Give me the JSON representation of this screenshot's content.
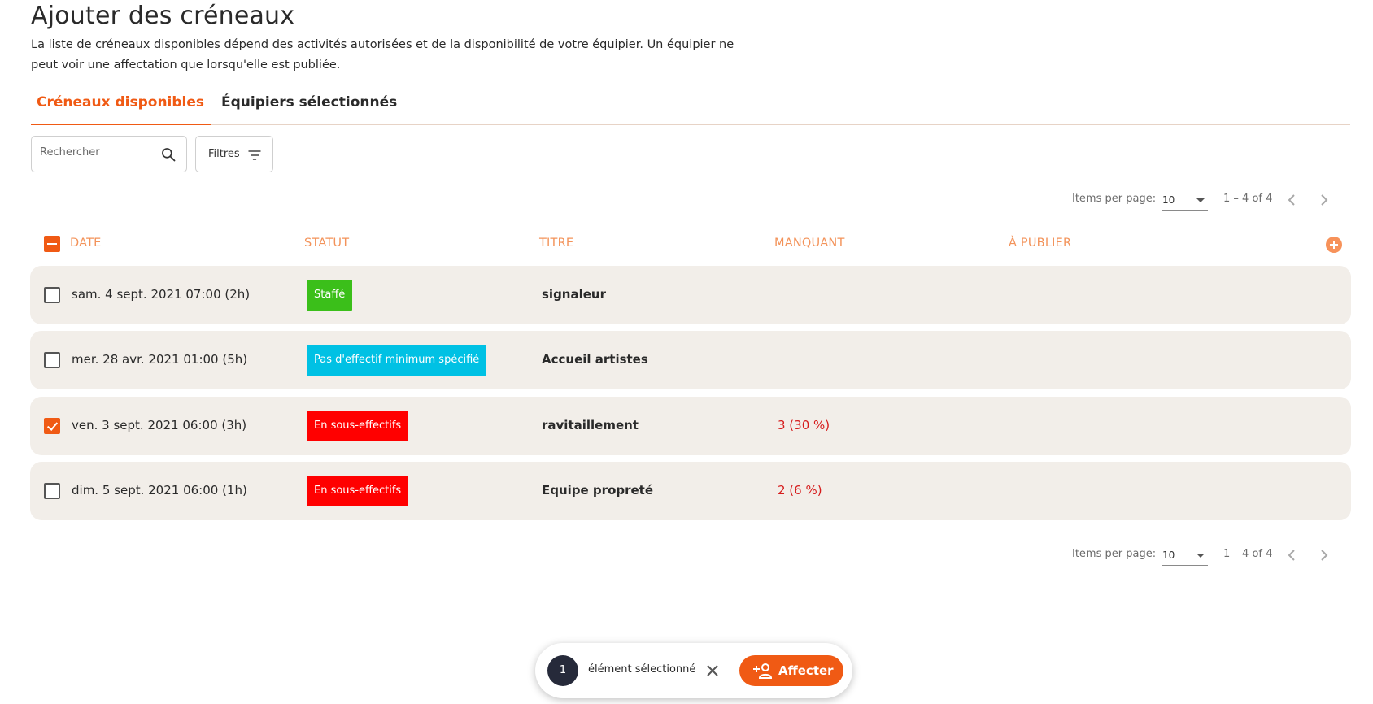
{
  "page": {
    "title": "Ajouter des créneaux",
    "description": "La liste de créneaux disponibles dépend des activités autorisées et de la disponibilité de votre équipier. Un équipier ne peut voir une affectation que lorsqu'elle est publiée."
  },
  "tabs": [
    {
      "label": "Créneaux disponibles",
      "active": true
    },
    {
      "label": "Équipiers sélectionnés",
      "active": false
    }
  ],
  "search": {
    "placeholder": "Rechercher",
    "value": "",
    "icon": "search-icon"
  },
  "filters": {
    "label": "Filtres",
    "icon": "filter-icon"
  },
  "paginator": {
    "items_per_page_label": "Items per page:",
    "page_size": "10",
    "range_label": "1 – 4 of 4"
  },
  "table": {
    "headers": {
      "date": "DATE",
      "statut": "STATUT",
      "titre": "TITRE",
      "manquant": "MANQUANT",
      "a_publier": "À PUBLIER"
    },
    "rows": [
      {
        "date": "sam. 4 sept. 2021 07:00 (2h)",
        "statut": "Staffé",
        "statut_color": "#3bbf1a",
        "titre": "signaleur",
        "manquant": "",
        "checked": false
      },
      {
        "date": "mer. 28 avr. 2021 01:00 (5h)",
        "statut": "Pas d'effectif minimum spécifié",
        "statut_color": "#00c1e4",
        "titre": "Accueil artistes",
        "manquant": "",
        "checked": false
      },
      {
        "date": "ven. 3 sept. 2021 06:00 (3h)",
        "statut": "En sous-effectifs",
        "statut_color": "#ff0000",
        "titre": "ravitaillement",
        "manquant": "3 (30 %)",
        "checked": true
      },
      {
        "date": "dim. 5 sept. 2021 06:00 (1h)",
        "statut": "En sous-effectifs",
        "statut_color": "#ff0000",
        "titre": "Equipe propreté",
        "manquant": "2 (6 %)",
        "checked": false
      }
    ]
  },
  "selection_bar": {
    "count": "1",
    "label": "élément sélectionné",
    "action_label": "Affecter",
    "action_icon": "add-person-icon"
  },
  "colors": {
    "accent": "#f05a14",
    "header_text": "#f3935a",
    "row_background": "#f2eee9",
    "missing_text": "#d61c1c"
  }
}
